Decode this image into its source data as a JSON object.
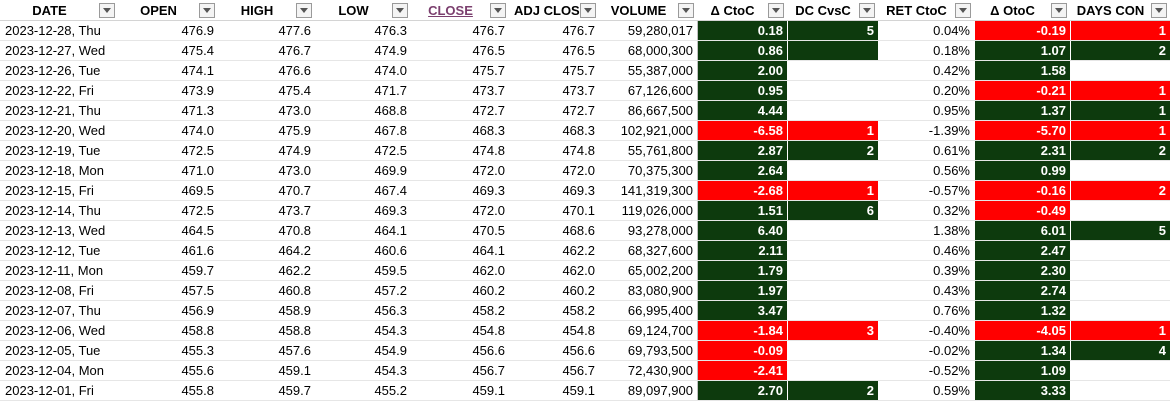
{
  "headers": [
    "DATE",
    "OPEN",
    "HIGH",
    "LOW",
    "CLOSE",
    "ADJ CLOS",
    "VOLUME",
    "Δ CtoC",
    "DC CvsC",
    "RET CtoC",
    "Δ OtoC",
    "DAYS CON"
  ],
  "rows": [
    {
      "date": "2023-12-28, Thu",
      "open": "476.9",
      "high": "477.6",
      "low": "476.3",
      "close": "476.7",
      "adj": "476.7",
      "volume": "59,280,017",
      "dctoc": "0.18",
      "dctoc_sign": "pos",
      "dccvsc": "5",
      "dccvsc_sign": "pos",
      "ret": "0.04%",
      "dotoc": "-0.19",
      "dotoc_sign": "neg",
      "days": "1",
      "days_sign": "neg"
    },
    {
      "date": "2023-12-27, Wed",
      "open": "475.4",
      "high": "476.7",
      "low": "474.9",
      "close": "476.5",
      "adj": "476.5",
      "volume": "68,000,300",
      "dctoc": "0.86",
      "dctoc_sign": "pos",
      "dccvsc": "",
      "dccvsc_sign": "pos",
      "ret": "0.18%",
      "dotoc": "1.07",
      "dotoc_sign": "pos",
      "days": "2",
      "days_sign": "pos"
    },
    {
      "date": "2023-12-26, Tue",
      "open": "474.1",
      "high": "476.6",
      "low": "474.0",
      "close": "475.7",
      "adj": "475.7",
      "volume": "55,387,000",
      "dctoc": "2.00",
      "dctoc_sign": "pos",
      "dccvsc": "",
      "dccvsc_sign": "blank",
      "ret": "0.42%",
      "dotoc": "1.58",
      "dotoc_sign": "pos",
      "days": "",
      "days_sign": "blank"
    },
    {
      "date": "2023-12-22, Fri",
      "open": "473.9",
      "high": "475.4",
      "low": "471.7",
      "close": "473.7",
      "adj": "473.7",
      "volume": "67,126,600",
      "dctoc": "0.95",
      "dctoc_sign": "pos",
      "dccvsc": "",
      "dccvsc_sign": "blank",
      "ret": "0.20%",
      "dotoc": "-0.21",
      "dotoc_sign": "neg",
      "days": "1",
      "days_sign": "neg"
    },
    {
      "date": "2023-12-21, Thu",
      "open": "471.3",
      "high": "473.0",
      "low": "468.8",
      "close": "472.7",
      "adj": "472.7",
      "volume": "86,667,500",
      "dctoc": "4.44",
      "dctoc_sign": "pos",
      "dccvsc": "",
      "dccvsc_sign": "blank",
      "ret": "0.95%",
      "dotoc": "1.37",
      "dotoc_sign": "pos",
      "days": "1",
      "days_sign": "pos"
    },
    {
      "date": "2023-12-20, Wed",
      "open": "474.0",
      "high": "475.9",
      "low": "467.8",
      "close": "468.3",
      "adj": "468.3",
      "volume": "102,921,000",
      "dctoc": "-6.58",
      "dctoc_sign": "neg",
      "dccvsc": "1",
      "dccvsc_sign": "neg",
      "ret": "-1.39%",
      "dotoc": "-5.70",
      "dotoc_sign": "neg",
      "days": "1",
      "days_sign": "neg"
    },
    {
      "date": "2023-12-19, Tue",
      "open": "472.5",
      "high": "474.9",
      "low": "472.5",
      "close": "474.8",
      "adj": "474.8",
      "volume": "55,761,800",
      "dctoc": "2.87",
      "dctoc_sign": "pos",
      "dccvsc": "2",
      "dccvsc_sign": "pos",
      "ret": "0.61%",
      "dotoc": "2.31",
      "dotoc_sign": "pos",
      "days": "2",
      "days_sign": "pos"
    },
    {
      "date": "2023-12-18, Mon",
      "open": "471.0",
      "high": "473.0",
      "low": "469.9",
      "close": "472.0",
      "adj": "472.0",
      "volume": "70,375,300",
      "dctoc": "2.64",
      "dctoc_sign": "pos",
      "dccvsc": "",
      "dccvsc_sign": "blank",
      "ret": "0.56%",
      "dotoc": "0.99",
      "dotoc_sign": "pos",
      "days": "",
      "days_sign": "blank"
    },
    {
      "date": "2023-12-15, Fri",
      "open": "469.5",
      "high": "470.7",
      "low": "467.4",
      "close": "469.3",
      "adj": "469.3",
      "volume": "141,319,300",
      "dctoc": "-2.68",
      "dctoc_sign": "neg",
      "dccvsc": "1",
      "dccvsc_sign": "neg",
      "ret": "-0.57%",
      "dotoc": "-0.16",
      "dotoc_sign": "neg",
      "days": "2",
      "days_sign": "neg"
    },
    {
      "date": "2023-12-14, Thu",
      "open": "472.5",
      "high": "473.7",
      "low": "469.3",
      "close": "472.0",
      "adj": "470.1",
      "volume": "119,026,000",
      "dctoc": "1.51",
      "dctoc_sign": "pos",
      "dccvsc": "6",
      "dccvsc_sign": "pos",
      "ret": "0.32%",
      "dotoc": "-0.49",
      "dotoc_sign": "neg",
      "days": "",
      "days_sign": "blank"
    },
    {
      "date": "2023-12-13, Wed",
      "open": "464.5",
      "high": "470.8",
      "low": "464.1",
      "close": "470.5",
      "adj": "468.6",
      "volume": "93,278,000",
      "dctoc": "6.40",
      "dctoc_sign": "pos",
      "dccvsc": "",
      "dccvsc_sign": "blank",
      "ret": "1.38%",
      "dotoc": "6.01",
      "dotoc_sign": "pos",
      "days": "5",
      "days_sign": "pos"
    },
    {
      "date": "2023-12-12, Tue",
      "open": "461.6",
      "high": "464.2",
      "low": "460.6",
      "close": "464.1",
      "adj": "462.2",
      "volume": "68,327,600",
      "dctoc": "2.11",
      "dctoc_sign": "pos",
      "dccvsc": "",
      "dccvsc_sign": "blank",
      "ret": "0.46%",
      "dotoc": "2.47",
      "dotoc_sign": "pos",
      "days": "",
      "days_sign": "blank"
    },
    {
      "date": "2023-12-11, Mon",
      "open": "459.7",
      "high": "462.2",
      "low": "459.5",
      "close": "462.0",
      "adj": "462.0",
      "volume": "65,002,200",
      "dctoc": "1.79",
      "dctoc_sign": "pos",
      "dccvsc": "",
      "dccvsc_sign": "blank",
      "ret": "0.39%",
      "dotoc": "2.30",
      "dotoc_sign": "pos",
      "days": "",
      "days_sign": "blank"
    },
    {
      "date": "2023-12-08, Fri",
      "open": "457.5",
      "high": "460.8",
      "low": "457.2",
      "close": "460.2",
      "adj": "460.2",
      "volume": "83,080,900",
      "dctoc": "1.97",
      "dctoc_sign": "pos",
      "dccvsc": "",
      "dccvsc_sign": "blank",
      "ret": "0.43%",
      "dotoc": "2.74",
      "dotoc_sign": "pos",
      "days": "",
      "days_sign": "blank"
    },
    {
      "date": "2023-12-07, Thu",
      "open": "456.9",
      "high": "458.9",
      "low": "456.3",
      "close": "458.2",
      "adj": "458.2",
      "volume": "66,995,400",
      "dctoc": "3.47",
      "dctoc_sign": "pos",
      "dccvsc": "",
      "dccvsc_sign": "blank",
      "ret": "0.76%",
      "dotoc": "1.32",
      "dotoc_sign": "pos",
      "days": "",
      "days_sign": "blank"
    },
    {
      "date": "2023-12-06, Wed",
      "open": "458.8",
      "high": "458.8",
      "low": "454.3",
      "close": "454.8",
      "adj": "454.8",
      "volume": "69,124,700",
      "dctoc": "-1.84",
      "dctoc_sign": "neg",
      "dccvsc": "3",
      "dccvsc_sign": "neg",
      "ret": "-0.40%",
      "dotoc": "-4.05",
      "dotoc_sign": "neg",
      "days": "1",
      "days_sign": "neg"
    },
    {
      "date": "2023-12-05, Tue",
      "open": "455.3",
      "high": "457.6",
      "low": "454.9",
      "close": "456.6",
      "adj": "456.6",
      "volume": "69,793,500",
      "dctoc": "-0.09",
      "dctoc_sign": "neg",
      "dccvsc": "",
      "dccvsc_sign": "blank",
      "ret": "-0.02%",
      "dotoc": "1.34",
      "dotoc_sign": "pos",
      "days": "4",
      "days_sign": "pos"
    },
    {
      "date": "2023-12-04, Mon",
      "open": "455.6",
      "high": "459.1",
      "low": "454.3",
      "close": "456.7",
      "adj": "456.7",
      "volume": "72,430,900",
      "dctoc": "-2.41",
      "dctoc_sign": "neg",
      "dccvsc": "",
      "dccvsc_sign": "blank",
      "ret": "-0.52%",
      "dotoc": "1.09",
      "dotoc_sign": "pos",
      "days": "",
      "days_sign": "blank"
    },
    {
      "date": "2023-12-01, Fri",
      "open": "455.8",
      "high": "459.7",
      "low": "455.2",
      "close": "459.1",
      "adj": "459.1",
      "volume": "89,097,900",
      "dctoc": "2.70",
      "dctoc_sign": "pos",
      "dccvsc": "2",
      "dccvsc_sign": "pos",
      "ret": "0.59%",
      "dotoc": "3.33",
      "dotoc_sign": "pos",
      "days": "",
      "days_sign": "blank"
    }
  ],
  "colors": {
    "positive": "#0d3a0d",
    "negative": "#ff0000",
    "close_header": "#7b3f6e"
  }
}
